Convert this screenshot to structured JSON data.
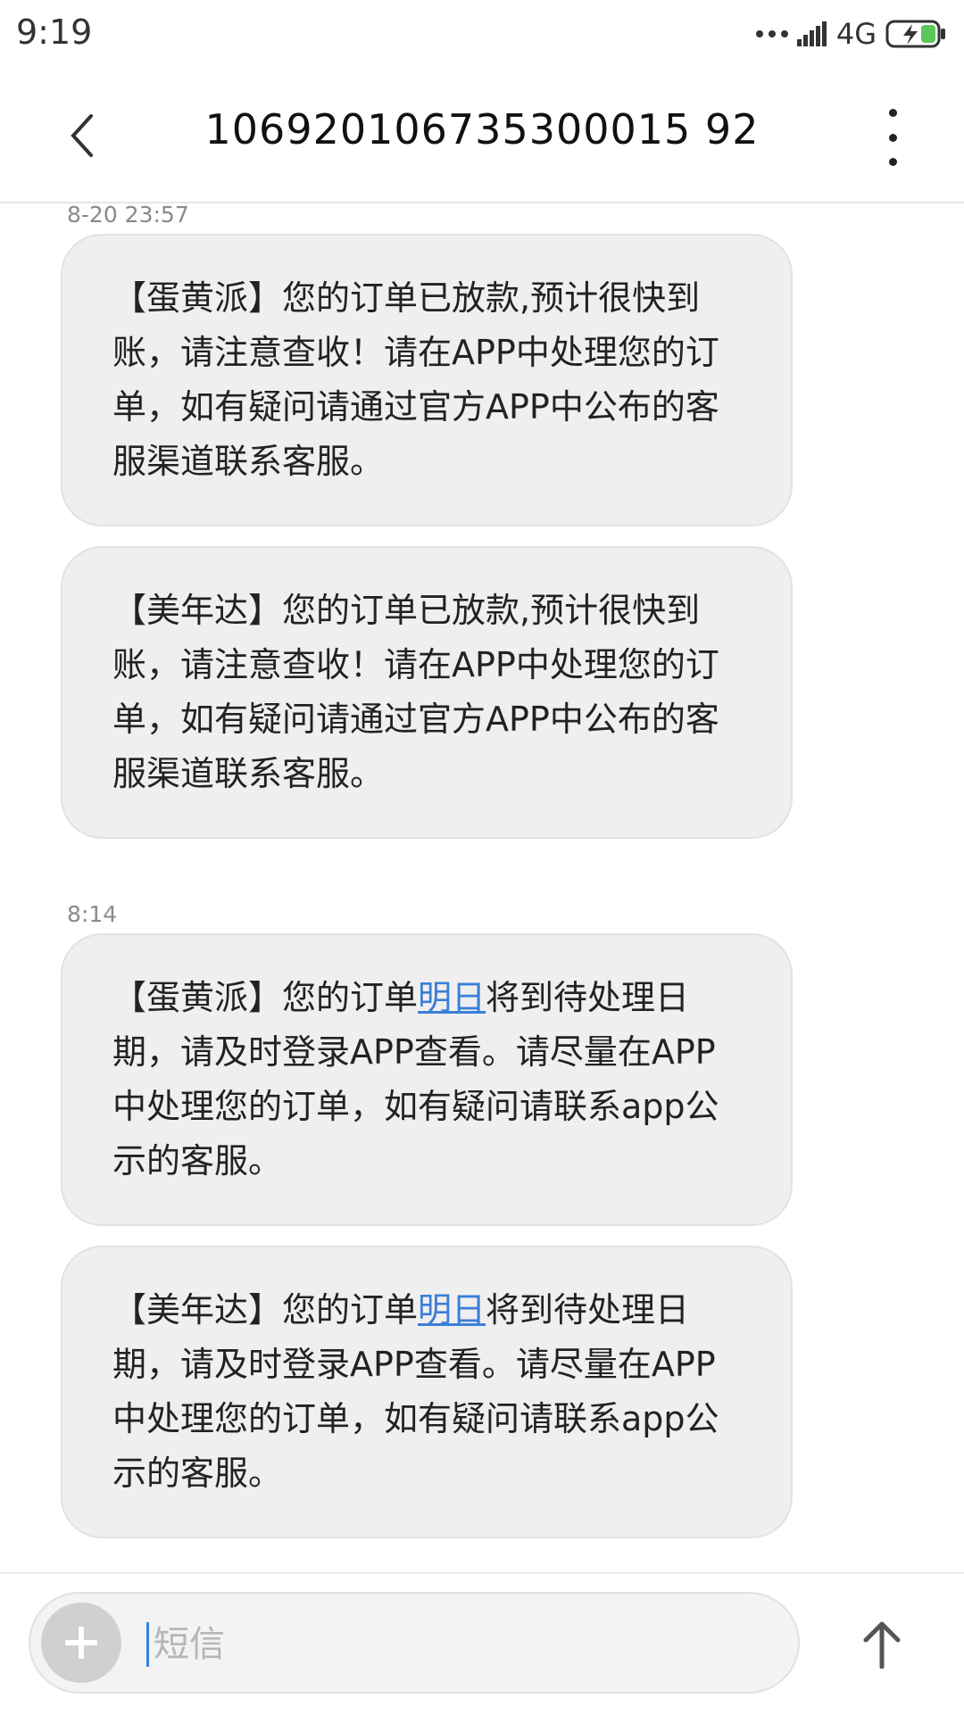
{
  "status_bar": {
    "time": "9:19",
    "network": "4G",
    "signal_icon": "signal-icon",
    "battery_icon": "battery-charging-icon"
  },
  "header": {
    "title": "106920106735300015 92",
    "back_icon": "chevron-left-icon",
    "more_icon": "more-vertical-icon"
  },
  "conversation": {
    "groups": [
      {
        "timestamp": "8-20 23:57",
        "messages": [
          {
            "text": "【蛋黄派】您的订单已放款,预计很快到账，请注意查收！请在APP中处理您的订单，如有疑问请通过官方APP中公布的客服渠道联系客服。"
          },
          {
            "text": "【美年达】您的订单已放款,预计很快到账，请注意查收！请在APP中处理您的订单，如有疑问请通过官方APP中公布的客服渠道联系客服。"
          }
        ]
      },
      {
        "timestamp": "8:14",
        "messages": [
          {
            "prefix": "【蛋黄派】您的订单",
            "link": "明日",
            "suffix": "将到待处理日期，请及时登录APP查看。请尽量在APP中处理您的订单，如有疑问请联系app公示的客服。"
          },
          {
            "prefix": "【美年达】您的订单",
            "link": "明日",
            "suffix": "将到待处理日期，请及时登录APP查看。请尽量在APP中处理您的订单，如有疑问请联系app公示的客服。"
          }
        ]
      }
    ]
  },
  "composer": {
    "placeholder": "短信",
    "add_icon": "plus-icon",
    "send_icon": "arrow-up-icon"
  },
  "colors": {
    "bubble": "#efefef",
    "link": "#3a7fd8",
    "cursor": "#2f86e8"
  }
}
